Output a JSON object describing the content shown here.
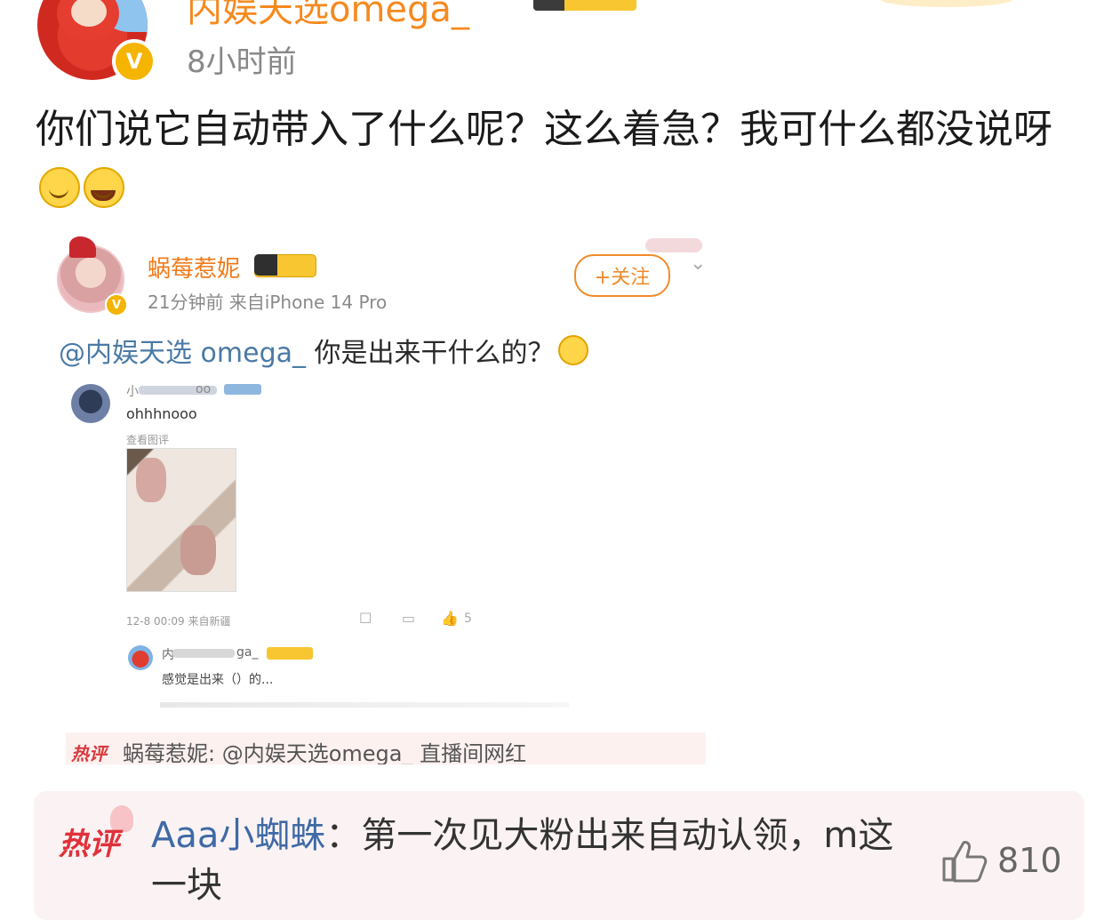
{
  "post": {
    "username": "内娱天选omega_",
    "time": "8小时前",
    "verified_badge": "V",
    "text": "你们说它自动带入了什么呢？这么着急？我可什么都没说呀"
  },
  "embedded": {
    "username": "蜗莓惹妮",
    "level_badge": "Ⅲ",
    "meta": "21分钟前  来自iPhone 14 Pro",
    "follow_label": "+关注",
    "verified_badge": "V",
    "mention": "@内娱天选 omega_",
    "text": " 你是出来干什么的？",
    "comment1": {
      "name_start": "小",
      "name_end": "oo",
      "text": "ohhhnooo",
      "view": "查看图评",
      "meta": "12-8 00:09  来自新疆",
      "like_count": "5"
    },
    "comment2": {
      "name_start": "内",
      "name_end": "ga_",
      "text": "感觉是出来（）的..."
    },
    "hot_label": "热评",
    "hot_text": "蜗莓惹妮: @内娱天选omega_ 直播间网红"
  },
  "hot_comment": {
    "label": "热评",
    "user": "Aaa小蜘蛛",
    "separator": "：",
    "text": "第一次见大粉出来自动认领，m这一块",
    "likes": "810"
  },
  "icons": {
    "verified": "verified-badge-icon",
    "like": "thumb-up-icon",
    "more": "chevron-down-icon"
  },
  "colors": {
    "username_orange": "#f58a1f",
    "mention_blue": "#4b7aa6",
    "hot_red": "#e0313b",
    "hot_bg": "#fbf3f3"
  }
}
